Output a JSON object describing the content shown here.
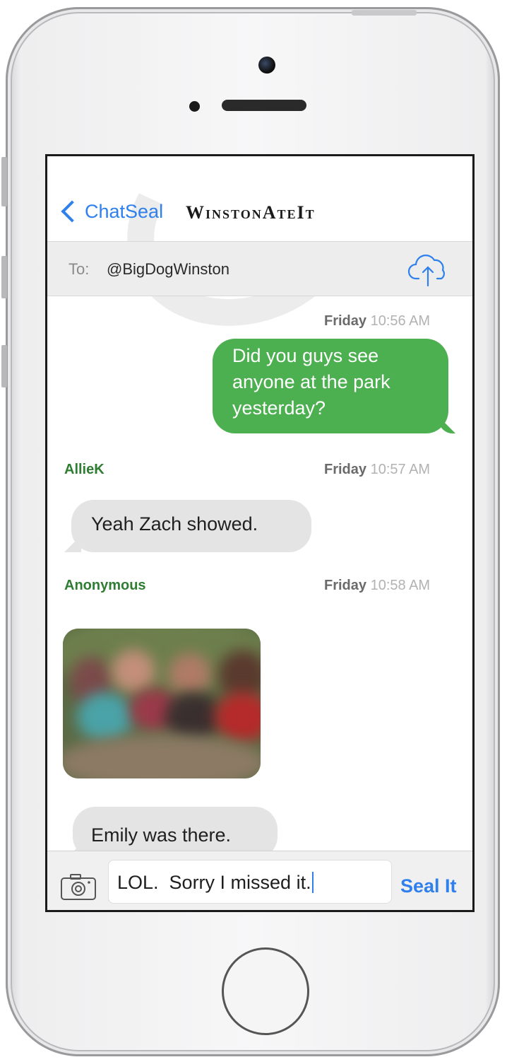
{
  "nav": {
    "back_label": "ChatSeal",
    "title": "WinstonAteIt"
  },
  "recipient": {
    "to_label": "To:",
    "to_value": "@BigDogWinston",
    "upload_icon": "cloud-upload-icon"
  },
  "messages": [
    {
      "direction": "outgoing",
      "day": "Friday",
      "time": "10:56 AM",
      "lines": [
        "Did you guys see",
        "anyone at the park",
        "yesterday?"
      ]
    },
    {
      "direction": "incoming",
      "sender": "AllieK",
      "day": "Friday",
      "time": "10:57 AM",
      "text": "Yeah Zach showed."
    },
    {
      "direction": "incoming",
      "sender": "Anonymous",
      "day": "Friday",
      "time": "10:58 AM",
      "attachment": "photo",
      "text": "Emily was there."
    }
  ],
  "compose": {
    "camera_icon": "camera-icon",
    "input_value": "LOL.  Sorry I missed it.",
    "send_label": "Seal It"
  },
  "colors": {
    "accent": "#2f80ed",
    "outgoing_bubble": "#4caf50",
    "incoming_bubble": "#e4e4e4",
    "sender_name": "#2f7d32"
  }
}
